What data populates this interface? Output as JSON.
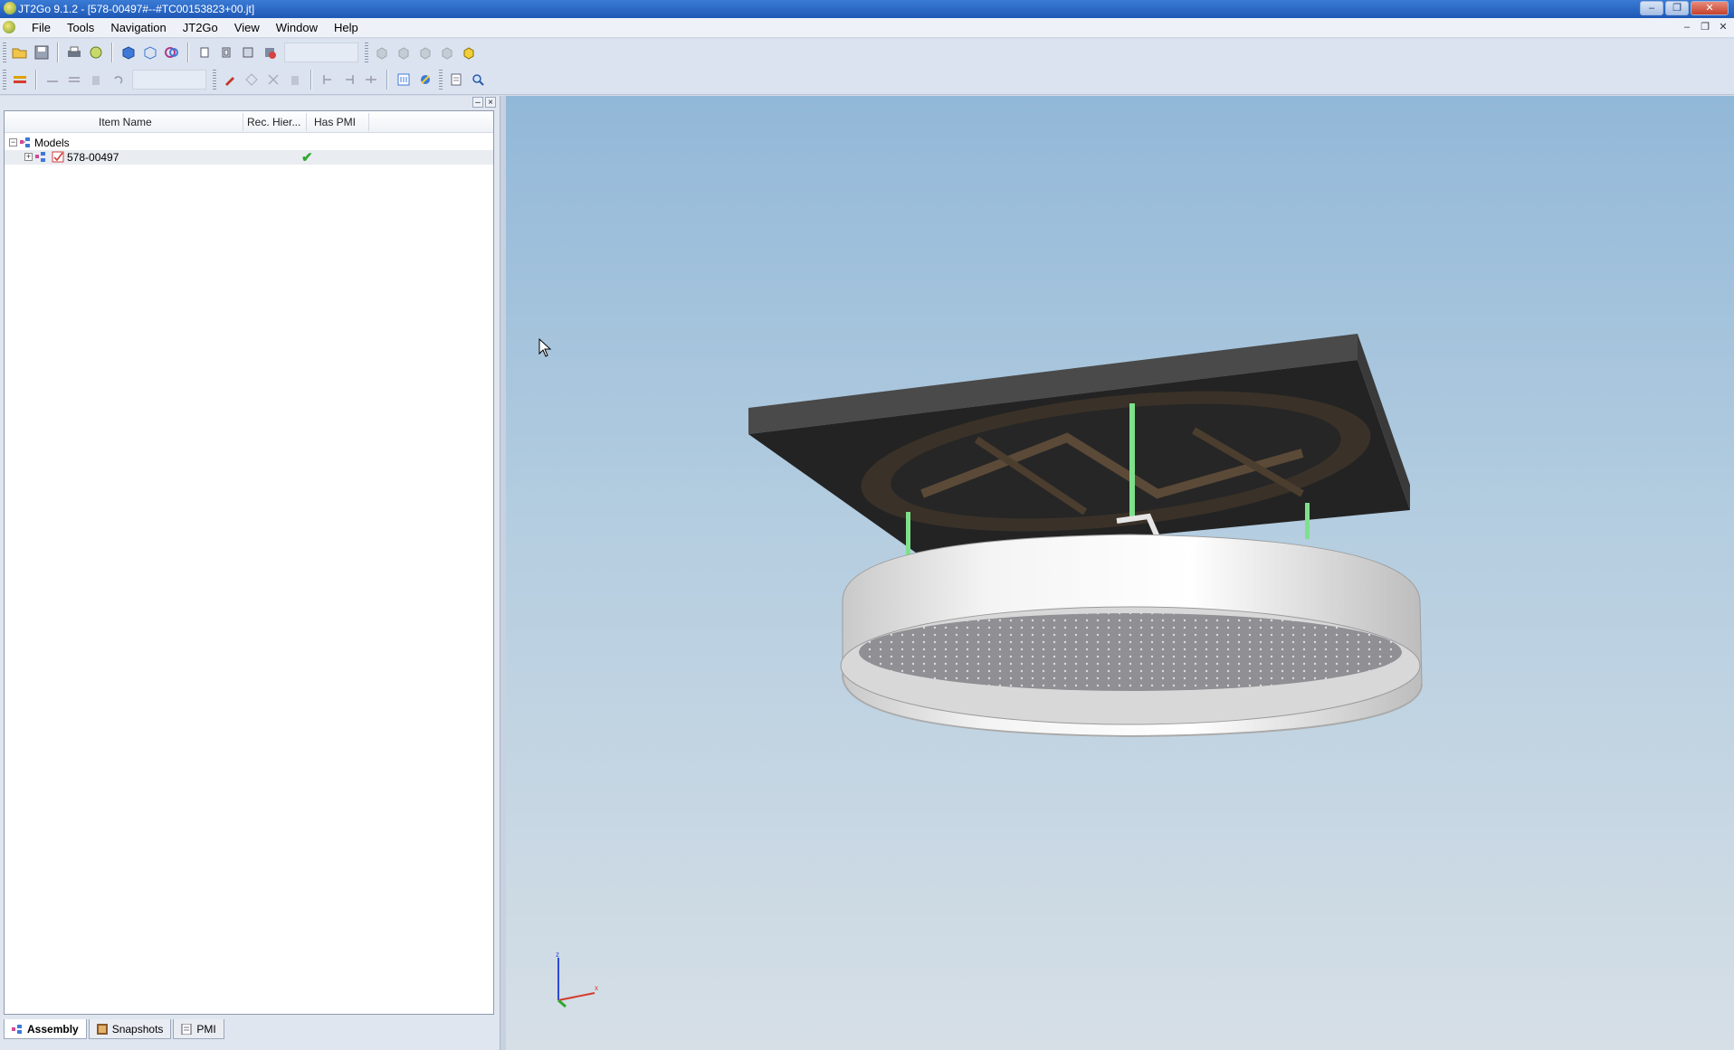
{
  "window": {
    "title": "JT2Go 9.1.2 - [578-00497#--#TC00153823+00.jt]",
    "buttons": {
      "minimize": "–",
      "maximize": "❐",
      "close": "✕"
    }
  },
  "menubar": {
    "items": [
      "File",
      "Tools",
      "Navigation",
      "JT2Go",
      "View",
      "Window",
      "Help"
    ],
    "mdi": {
      "minimize": "–",
      "restore": "❐",
      "close": "✕"
    }
  },
  "panel": {
    "header_buttons": {
      "pin": "–",
      "close": "×"
    },
    "columns": [
      "Item Name",
      "Rec. Hier...",
      "Has PMI"
    ],
    "tree": [
      {
        "label": "Models",
        "expander": "−"
      },
      {
        "label": "578-00497",
        "expander": "+",
        "has_pmi": "✔"
      }
    ],
    "tabs": [
      "Assembly",
      "Snapshots",
      "PMI"
    ],
    "active_tab": "Assembly"
  },
  "viewport": {
    "triad": {
      "z_label": "z",
      "x_label": "x"
    },
    "colors": {
      "bg_top": "#92b8d8",
      "bg_bottom": "#d6dfe6",
      "plate": "#2b2b2b",
      "rods": "#7ee08a",
      "shower_head": "#efefef"
    }
  }
}
